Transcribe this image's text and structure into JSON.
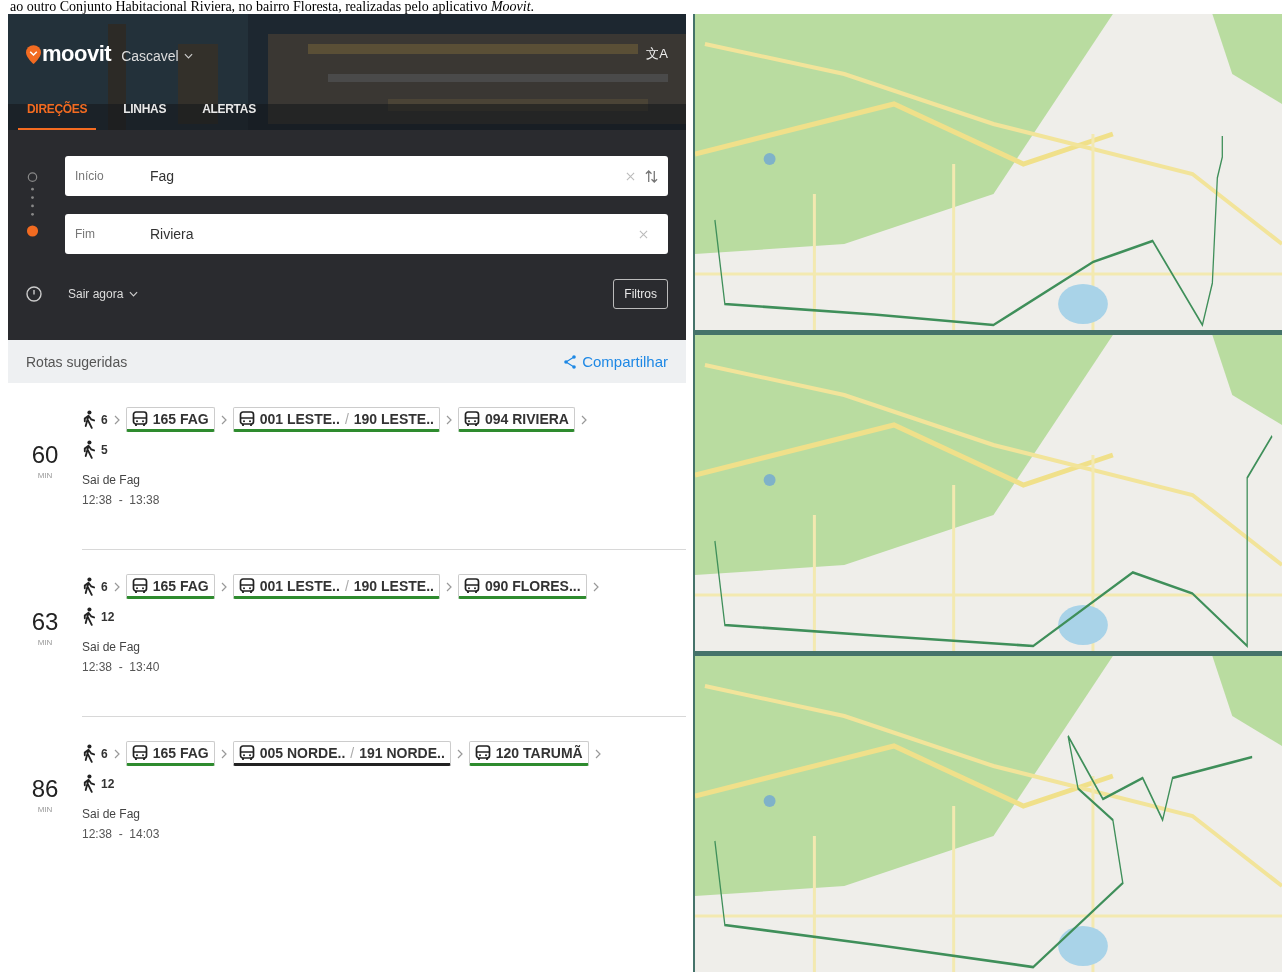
{
  "caption": "ao outro Conjunto Habitacional Riviera, no bairro Floresta, realizadas pelo aplicativo *Moovit*.",
  "header": {
    "logo": "moovit",
    "city": "Cascavel",
    "translate": "文A"
  },
  "tabs": [
    {
      "label": "DIREÇÕES",
      "selected": true
    },
    {
      "label": "LINHAS",
      "selected": false
    },
    {
      "label": "ALERTAS",
      "selected": false
    }
  ],
  "form": {
    "start": {
      "label": "Início",
      "value": "Fag"
    },
    "end": {
      "label": "Fim",
      "value": "Riviera"
    },
    "time": "Sair agora",
    "filters": "Filtros"
  },
  "routes_header": {
    "title": "Rotas sugeridas",
    "share": "Compartilhar"
  },
  "routes": [
    {
      "minutes": "60",
      "unit": "MIN",
      "walk_start": "6",
      "walk_end": "5",
      "origin": "Sai de Fag",
      "times": "12:38  -  13:38",
      "legs": [
        {
          "name": "165 FAG",
          "color": "#2e8b2e"
        },
        {
          "name": "001 LESTE..",
          "separator": "/",
          "second": "190 LESTE..",
          "color": "#2e8b2e"
        },
        {
          "name": "094 RIVIERA",
          "color": "#2e8b2e"
        }
      ]
    },
    {
      "minutes": "63",
      "unit": "MIN",
      "walk_start": "6",
      "walk_end": "12",
      "origin": "Sai de Fag",
      "times": "12:38  -  13:40",
      "legs": [
        {
          "name": "165 FAG",
          "color": "#2e8b2e"
        },
        {
          "name": "001 LESTE..",
          "separator": "/",
          "second": "190 LESTE..",
          "color": "#2e8b2e"
        },
        {
          "name": "090 FLORES...",
          "color": "#2e8b2e"
        }
      ]
    },
    {
      "minutes": "86",
      "unit": "MIN",
      "walk_start": "6",
      "walk_end": "12",
      "origin": "Sai de Fag",
      "times": "12:38  -  14:03",
      "legs": [
        {
          "name": "165 FAG",
          "color": "#2e8b2e"
        },
        {
          "name": "005 NORDE..",
          "separator": "/",
          "second": "191 NORDE..",
          "color": "#222222"
        },
        {
          "name": "120 TARUMÃ",
          "color": "#2e8b2e"
        }
      ]
    }
  ]
}
